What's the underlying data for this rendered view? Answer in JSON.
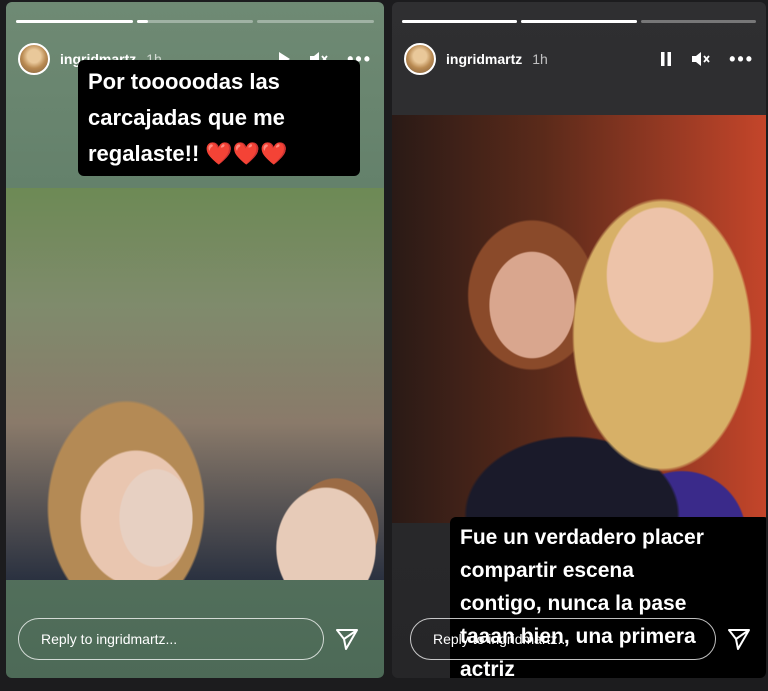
{
  "left_story": {
    "username": "ingridmartz",
    "time": "1h",
    "caption_lines": [
      "Por tooooodas las",
      "carcajadas que me",
      "regalaste!! ❤️❤️❤️"
    ],
    "reply_placeholder": "Reply to ingridmartz...",
    "progress": [
      1.0,
      0.1,
      0
    ]
  },
  "right_story": {
    "username": "ingridmartz",
    "time": "1h",
    "caption_lines": [
      "Fue un verdadero placer",
      "compartir escena",
      "contigo, nunca la pase",
      "taaan bien, una primera",
      "actriz"
    ],
    "reply_placeholder": "Reply to ingridmartz...",
    "progress": [
      1.0,
      1.0,
      0
    ]
  },
  "icons": {
    "play": "play-icon",
    "pause": "pause-icon",
    "mute": "mute-icon",
    "more": "more-icon",
    "send": "send-icon"
  }
}
